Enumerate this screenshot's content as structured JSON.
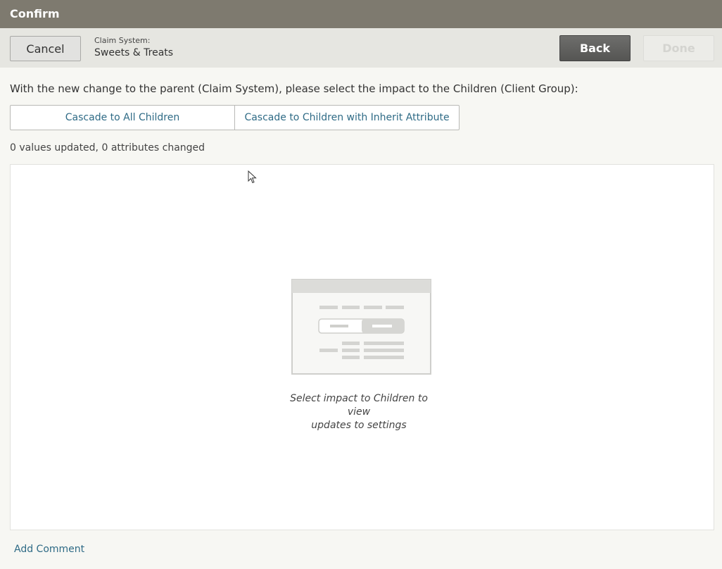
{
  "window": {
    "title": "Confirm"
  },
  "toolbar": {
    "cancel_label": "Cancel",
    "claim_system_label": "Claim System:",
    "claim_system_value": "Sweets & Treats",
    "back_label": "Back",
    "done_label": "Done"
  },
  "main": {
    "instruction": "With the new change to the parent (Claim System), please select the impact to the Children (Client Group):",
    "cascade_all_label": "Cascade to All Children",
    "cascade_inherit_label": "Cascade to Children with Inherit Attribute",
    "status": "0 values updated, 0 attributes changed",
    "empty_line1": "Select impact to Children to view",
    "empty_line2": "updates to settings"
  },
  "footer": {
    "add_comment_label": "Add Comment"
  },
  "icons": {
    "empty_state": "table-placeholder-icon",
    "cursor": "mouse-pointer-icon"
  },
  "colors": {
    "titlebar": "#7e7a6f",
    "accent_link": "#2f6b86",
    "primary_button": "#5f5f5d"
  }
}
